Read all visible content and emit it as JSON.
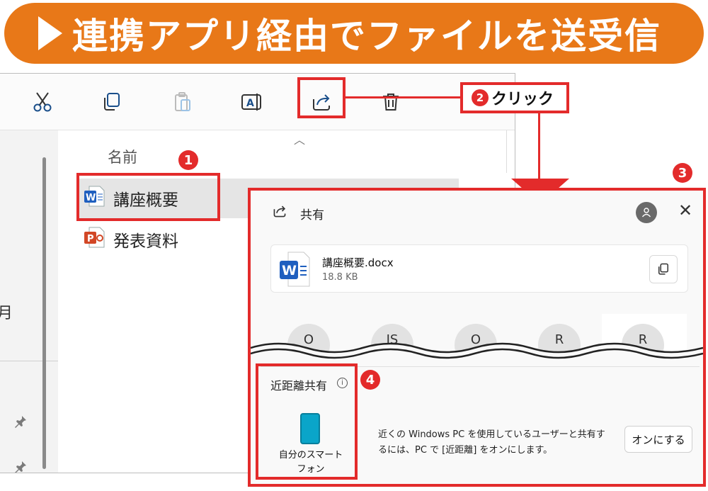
{
  "banner": {
    "title": "連携アプリ経由でファイルを送受信"
  },
  "explorer": {
    "column_header": "名前",
    "left_fragment": "月",
    "files": [
      {
        "name": "講座概要",
        "icon": "word-icon"
      },
      {
        "name": "発表資料",
        "icon": "powerpoint-icon"
      }
    ],
    "toolbar_icons": [
      "cut-icon",
      "copy-icon",
      "paste-icon",
      "rename-icon",
      "share-icon",
      "delete-icon"
    ]
  },
  "steps": {
    "s1": "1",
    "s2": "2",
    "s3": "3",
    "s4": "4"
  },
  "callout": {
    "label": "クリック"
  },
  "share_dialog": {
    "title": "共有",
    "file_name": "講座概要.docx",
    "file_size": "18.8 KB",
    "contacts": [
      "O",
      "JS",
      "O",
      "R",
      "R"
    ],
    "nearby_title": "近距離共有",
    "info": "i",
    "device_label": "自分のスマート\nフォン",
    "description": "近くの Windows PC を使用しているユーザーと共有するには、PC で [近距離] をオンにします。",
    "on_button": "オンにする"
  },
  "colors": {
    "banner": "#e87818",
    "highlight": "#e32b2b"
  }
}
